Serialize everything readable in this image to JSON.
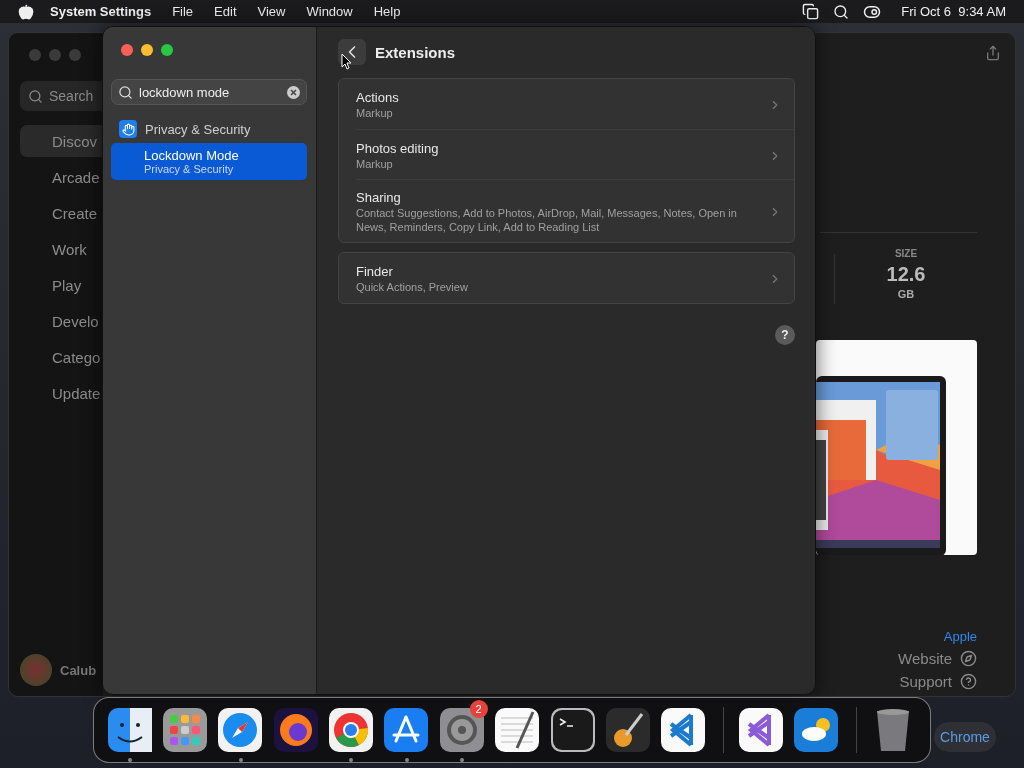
{
  "menu_bar": {
    "app_name": "System Settings",
    "menus": [
      "File",
      "Edit",
      "View",
      "Window",
      "Help"
    ],
    "clock": "Fri Oct 6  9:34 AM"
  },
  "background_window": {
    "search": {
      "placeholder": "Search"
    },
    "sidebar": [
      {
        "label": "Discov",
        "selected": true
      },
      {
        "label": "Arcade",
        "selected": false
      },
      {
        "label": "Create",
        "selected": false
      },
      {
        "label": "Work",
        "selected": false
      },
      {
        "label": "Play",
        "selected": false
      },
      {
        "label": "Develo",
        "selected": false
      },
      {
        "label": "Catego",
        "selected": false
      },
      {
        "label": "Update",
        "selected": false
      }
    ],
    "user": "Calub",
    "size": {
      "label": "SIZE",
      "value": "12.6",
      "unit": "GB"
    },
    "developer": "Apple",
    "links": [
      {
        "label": "Website",
        "kind": "web"
      },
      {
        "label": "Support",
        "kind": "help"
      }
    ],
    "open_button": "Chrome"
  },
  "settings_window": {
    "search": {
      "value": "lockdown mode"
    },
    "results": [
      {
        "title": "Privacy & Security",
        "kind": "category",
        "selected": false
      },
      {
        "title": "Lockdown Mode",
        "subtitle": "Privacy & Security",
        "kind": "item",
        "selected": true
      }
    ],
    "title": "Extensions",
    "groups": [
      [
        {
          "title": "Actions",
          "subtitle": "Markup"
        },
        {
          "title": "Photos editing",
          "subtitle": "Markup"
        },
        {
          "title": "Sharing",
          "subtitle": "Contact Suggestions, Add to Photos, AirDrop, Mail, Messages, Notes, Open in News, Reminders, Copy Link, Add to Reading List"
        }
      ],
      [
        {
          "title": "Finder",
          "subtitle": "Quick Actions, Preview"
        }
      ]
    ],
    "help": "?"
  },
  "dock": [
    {
      "kind": "finder",
      "running": true
    },
    {
      "kind": "launchpad",
      "running": false
    },
    {
      "kind": "safari",
      "running": true
    },
    {
      "kind": "firefox",
      "running": false
    },
    {
      "kind": "chrome",
      "running": true
    },
    {
      "kind": "appstore",
      "running": true
    },
    {
      "kind": "settings",
      "running": true,
      "badge": "2"
    },
    {
      "kind": "textedit",
      "running": false
    },
    {
      "kind": "terminal",
      "running": false
    },
    {
      "kind": "garageband",
      "running": false
    },
    {
      "kind": "vscode",
      "running": false
    },
    {
      "kind": "separator"
    },
    {
      "kind": "visualstudio",
      "running": false
    },
    {
      "kind": "weather",
      "running": false
    },
    {
      "kind": "separator"
    },
    {
      "kind": "trash",
      "running": false
    }
  ]
}
